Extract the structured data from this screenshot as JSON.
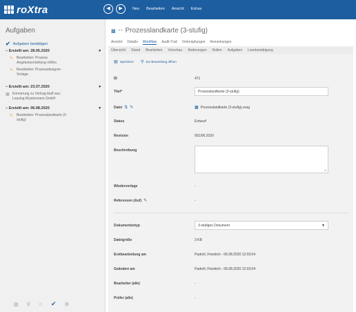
{
  "app": {
    "name_main": "roXtra",
    "menu": [
      "Neu",
      "Bearbeiten",
      "Ansicht",
      "Extras"
    ]
  },
  "sidebar": {
    "title": "Aufgaben",
    "confirm_label": "Aufgaben bestätigen",
    "groups": [
      {
        "header": "Erstellt am: 28.05.2020",
        "items": [
          {
            "icon": "edit-icon",
            "text": [
              "Bearbeiten: Prozess",
              "Angebotserstellung mRtra"
            ]
          },
          {
            "icon": "edit-icon",
            "text": [
              "Bearbeiten: Prozessdesigner",
              "Vorlage"
            ]
          }
        ]
      },
      {
        "header": "Erstellt am: 23.07.2020",
        "items": [
          {
            "icon": "calendar-icon",
            "text": [
              "Erinnerung zu Vertrag läuft aus:",
              "Leasing Mustermann GmbH"
            ]
          }
        ]
      },
      {
        "header": "Erstellt am: 06.08.2020",
        "items": [
          {
            "icon": "edit-icon",
            "text": [
              "Bearbeiten: Prozesslandkarte (3-",
              "stufig)"
            ]
          }
        ]
      }
    ],
    "bottom_icons": [
      "list-icon",
      "search-icon",
      "star-icon",
      "tasks-icon",
      "settings-icon"
    ]
  },
  "document": {
    "title": "Prozesslandkarte (3-stufig)",
    "tabs_primary": [
      "Ansicht",
      "Details",
      "Workflow",
      "Audit-Trail",
      "Verknüpfungen",
      "Anmerkungen"
    ],
    "active_primary": "Workflow",
    "tabs_secondary": [
      "Übersicht",
      "Stand",
      "Bearbeiten",
      "Vorschau",
      "Änderungen",
      "Rollen",
      "Aufgaben",
      "Lesebestätigung"
    ],
    "actions": {
      "save": "Speichern",
      "to_approval": "Zur Beurteilung öffnen"
    },
    "fields": {
      "id_label": "ID",
      "id_value": "471",
      "title_label": "Titel*",
      "title_value": "Prozesslandkarte (3-stufig)",
      "file_label": "Datei",
      "file_value": "Prozesslandkarte (3-stufig).vsxg",
      "status_label": "Status",
      "status_value": "Entwurf",
      "revision_label": "Revision",
      "revision_value": "001/06.2020",
      "description_label": "Beschreibung",
      "resubmission_label": "Wiedervorlage",
      "resubmission_value": "-",
      "references_label": "Referenzen (Auf)",
      "references_value": "-",
      "doctype_label": "Dokumententyp",
      "doctype_value": "3-stufiges Dokument",
      "filesize_label": "Dateigröße",
      "filesize_value": "3 KB",
      "created_label": "Erstbearbeitung am",
      "created_value": "Padroll, Friedrich - 06.08.2020 12:03:04",
      "modified_label": "Geändert am",
      "modified_value": "Padroll, Friedrich - 06.08.2020 12:03:04",
      "editor_label": "Bearbeiter (alle)",
      "editor_value": "-",
      "reviewer_label": "Prüfer (alle)",
      "reviewer_value": "-"
    }
  }
}
